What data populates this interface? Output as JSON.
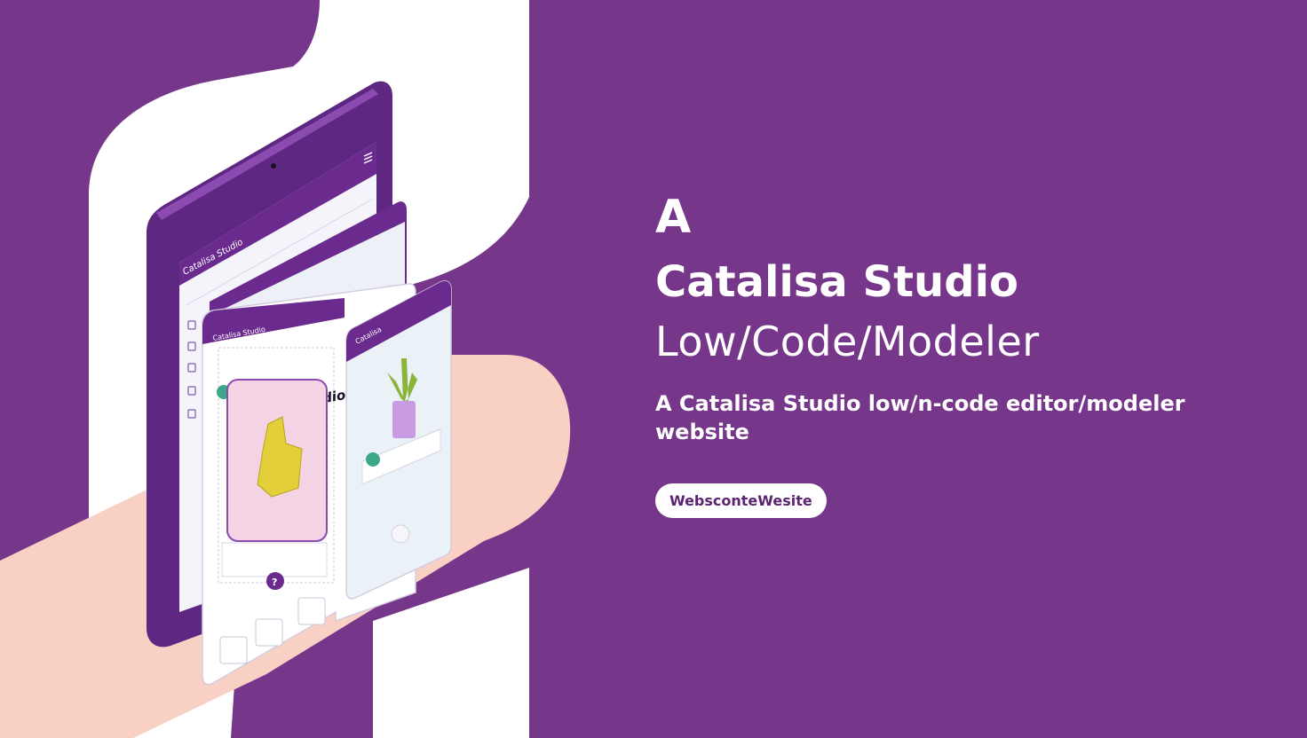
{
  "colors": {
    "background": "#76368a",
    "accent_purple": "#6a2a8e",
    "white": "#ffffff",
    "peach": "#f8d0c4",
    "teal": "#3aa889",
    "plant_green": "#8cb43a",
    "pot_lilac": "#c89be2",
    "product_yellow": "#e3cf3a",
    "product_bg": "#f3d3e4"
  },
  "tablet": {
    "header_title": "Catalisa Studio"
  },
  "middle_phone": {
    "header_title": "Catalisa Studio",
    "card_title": "Catalisa Studio",
    "help_icon_symbol": "?"
  },
  "small_phone": {
    "header_title": "Catalisa"
  },
  "hero": {
    "letter": "A",
    "title": "Catalisa Studio",
    "subtitle": "Low/Code/Modeler",
    "description": "A Catalisa Studio low/n-code editor/modeler website",
    "cta_label": "WebsconteWesite"
  }
}
